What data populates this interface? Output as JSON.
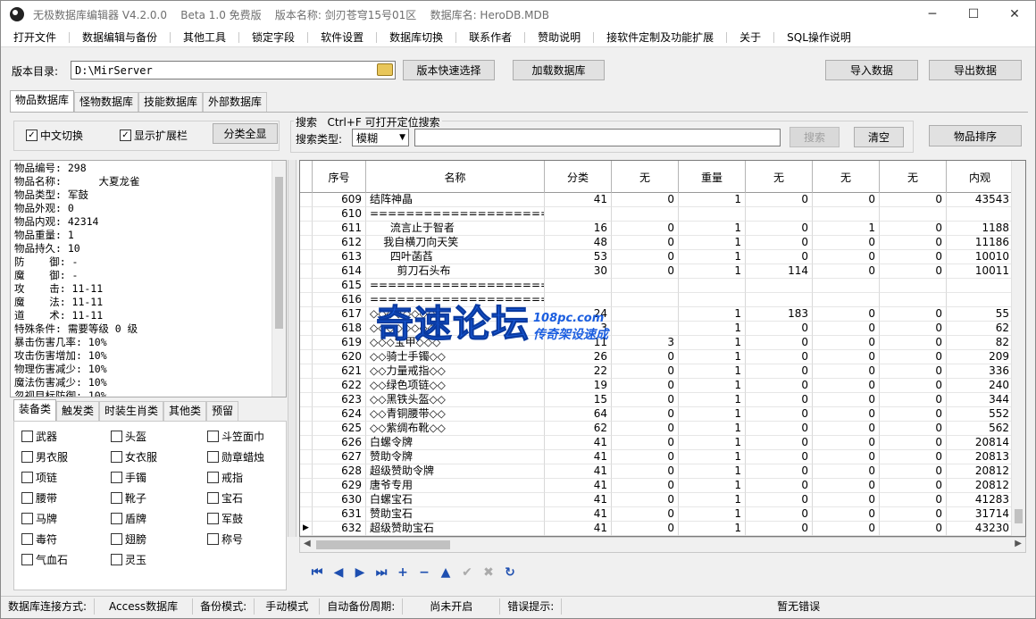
{
  "window": {
    "title": "无极数据库编辑器 V4.2.0.0    Beta 1.0 免费版    版本名称: 剑刃苍穹15号01区    数据库名: HeroDB.MDB"
  },
  "menu": [
    "打开文件",
    "数据编辑与备份",
    "其他工具",
    "锁定字段",
    "软件设置",
    "数据库切换",
    "联系作者",
    "赞助说明",
    "接软件定制及功能扩展",
    "关于",
    "SQL操作说明"
  ],
  "toolbar": {
    "dir_label": "版本目录:",
    "dir_value": "D:\\MirServer",
    "quick_select": "版本快速选择",
    "load_db": "加载数据库",
    "import": "导入数据",
    "export": "导出数据"
  },
  "tabs": [
    "物品数据库",
    "怪物数据库",
    "技能数据库",
    "外部数据库"
  ],
  "options": {
    "chinese_switch": "中文切换",
    "show_ext": "显示扩展栏",
    "show_all": "分类全显"
  },
  "search": {
    "title": "搜索   Ctrl+F 可打开定位搜索",
    "type_label": "搜索类型:",
    "type_value": "模糊",
    "search_btn": "搜索",
    "clear_btn": "清空",
    "sort_btn": "物品排序"
  },
  "info_lines": [
    "物品编号: 298",
    "物品名称:      大夏龙雀",
    "物品类型: 军鼓",
    "物品外观: 0",
    "物品内观: 42314",
    "物品重量: 1",
    "物品持久: 10",
    "防    御: -",
    "魔    御: -",
    "攻    击: 11-11",
    "魔    法: 11-11",
    "道    术: 11-11",
    "特殊条件: 需要等级 0 级",
    "暴击伤害几率: 10%",
    "攻击伤害增加: 10%",
    "物理伤害减少: 10%",
    "魔法伤害减少: 10%",
    "忽视目标防御: 10%"
  ],
  "cat_tabs": [
    "装备类",
    "触发类",
    "时装生肖类",
    "其他类",
    "预留"
  ],
  "categories": [
    "武器",
    "头盔",
    "斗笠面巾",
    "男衣服",
    "女衣服",
    "勋章蜡烛",
    "项链",
    "手镯",
    "戒指",
    "腰带",
    "靴子",
    "宝石",
    "马牌",
    "盾牌",
    "军鼓",
    "毒符",
    "翅膀",
    "称号",
    "气血石",
    "灵玉"
  ],
  "grid": {
    "headers": [
      "序号",
      "名称",
      "分类",
      "无",
      "重量",
      "无",
      "无",
      "无",
      "内观"
    ],
    "rows": [
      [
        "609",
        "结阵神晶",
        "41",
        "0",
        "1",
        "0",
        "0",
        "0",
        "43543"
      ],
      [
        "610",
        "=====================",
        "",
        "",
        "",
        "",
        "",
        "",
        ""
      ],
      [
        "611",
        "      流言止于智者",
        "16",
        "0",
        "1",
        "0",
        "1",
        "0",
        "1188"
      ],
      [
        "612",
        "    我自横刀向天笑",
        "48",
        "0",
        "1",
        "0",
        "0",
        "0",
        "11186"
      ],
      [
        "613",
        "      四叶菡萏",
        "53",
        "0",
        "1",
        "0",
        "0",
        "0",
        "10010"
      ],
      [
        "614",
        "        剪刀石头布",
        "30",
        "0",
        "1",
        "114",
        "0",
        "0",
        "10011"
      ],
      [
        "615",
        "=====================",
        "",
        "",
        "",
        "",
        "",
        "",
        ""
      ],
      [
        "616",
        "=====================",
        "",
        "",
        "",
        "",
        "",
        "",
        ""
      ],
      [
        "617",
        "◇◇◇◇◇◇◇◇",
        "24",
        "",
        "1",
        "183",
        "0",
        "0",
        "55"
      ],
      [
        "618",
        "◇◇◇◇◇◇◇◇",
        "3",
        "",
        "1",
        "0",
        "0",
        "0",
        "62"
      ],
      [
        "619",
        "◇◇◇宝甲◇◇◇",
        "11",
        "3",
        "1",
        "0",
        "0",
        "0",
        "82"
      ],
      [
        "620",
        "◇◇骑士手镯◇◇",
        "26",
        "0",
        "1",
        "0",
        "0",
        "0",
        "209"
      ],
      [
        "621",
        "◇◇力量戒指◇◇",
        "22",
        "0",
        "1",
        "0",
        "0",
        "0",
        "336"
      ],
      [
        "622",
        "◇◇绿色项链◇◇",
        "19",
        "0",
        "1",
        "0",
        "0",
        "0",
        "240"
      ],
      [
        "623",
        "◇◇黑铁头盔◇◇",
        "15",
        "0",
        "1",
        "0",
        "0",
        "0",
        "344"
      ],
      [
        "624",
        "◇◇青铜腰带◇◇",
        "64",
        "0",
        "1",
        "0",
        "0",
        "0",
        "552"
      ],
      [
        "625",
        "◇◇紫绸布靴◇◇",
        "62",
        "0",
        "1",
        "0",
        "0",
        "0",
        "562"
      ],
      [
        "626",
        "白螺令牌",
        "41",
        "0",
        "1",
        "0",
        "0",
        "0",
        "20814"
      ],
      [
        "627",
        "赞助令牌",
        "41",
        "0",
        "1",
        "0",
        "0",
        "0",
        "20813"
      ],
      [
        "628",
        "超级赞助令牌",
        "41",
        "0",
        "1",
        "0",
        "0",
        "0",
        "20812"
      ],
      [
        "629",
        "唐爷专用",
        "41",
        "0",
        "1",
        "0",
        "0",
        "0",
        "20812"
      ],
      [
        "630",
        "白螺宝石",
        "41",
        "0",
        "1",
        "0",
        "0",
        "0",
        "41283"
      ],
      [
        "631",
        "赞助宝石",
        "41",
        "0",
        "1",
        "0",
        "0",
        "0",
        "31714"
      ],
      [
        "632",
        "超级赞助宝石",
        "41",
        "0",
        "1",
        "0",
        "0",
        "0",
        "43230"
      ]
    ]
  },
  "nav": {
    "first": "⏮",
    "prev": "◀",
    "next": "▶",
    "last": "⏭",
    "add": "+",
    "remove": "−",
    "up": "▲",
    "confirm": "✔",
    "cancel": "✖",
    "refresh": "↻"
  },
  "status": [
    "数据库连接方式:",
    "Access数据库",
    "备份模式:",
    "手动模式",
    "自动备份周期:",
    "尚未开启",
    "错误提示:",
    "暂无错误"
  ],
  "watermark": {
    "main": "奇速论坛",
    "site": "108pc.com",
    "slogan": "传奇架设速成"
  },
  "colors": {
    "accent": "#1b5ee0"
  }
}
